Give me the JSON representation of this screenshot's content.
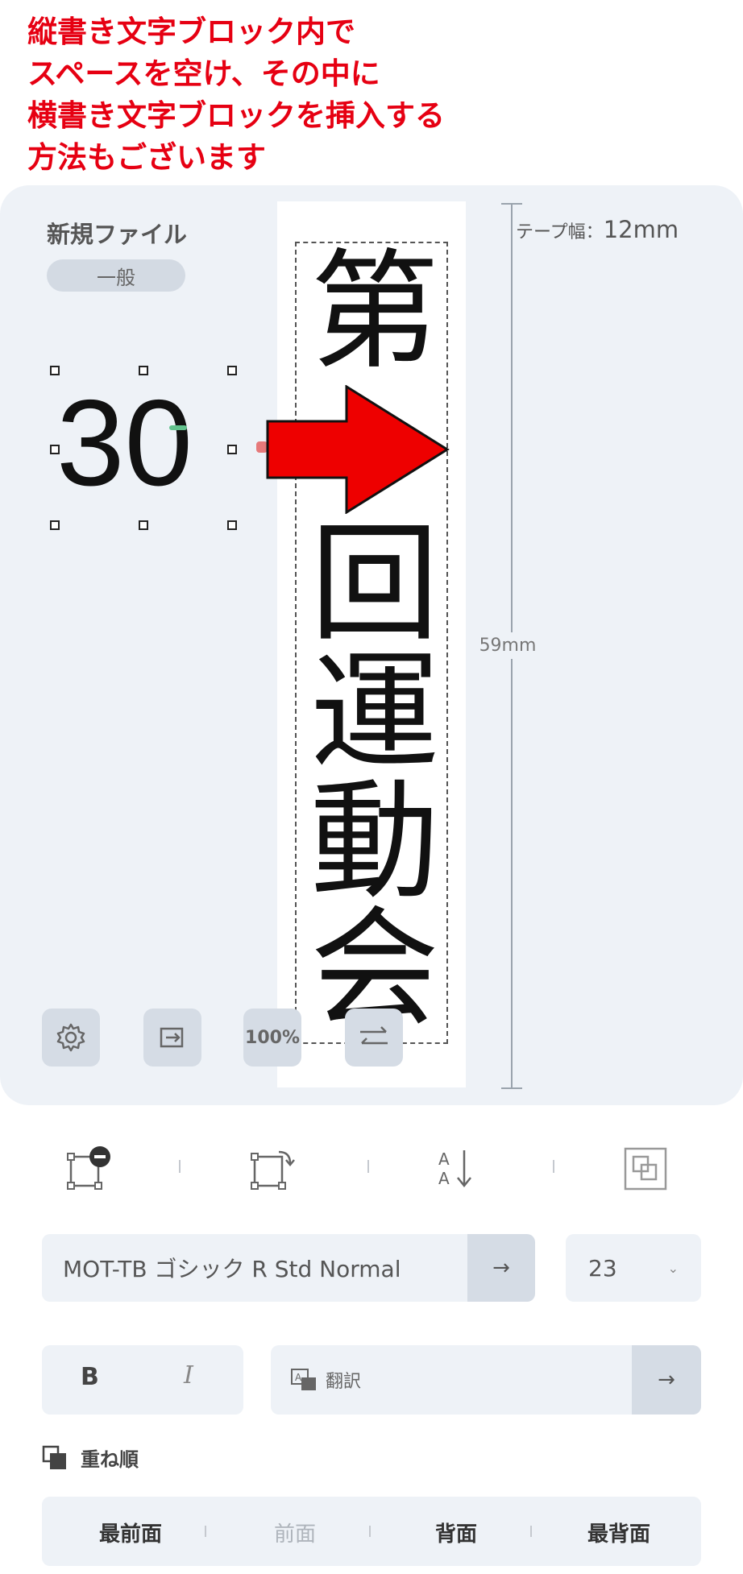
{
  "annotation": {
    "lines": [
      "縦書き文字ブロック内で",
      "スペースを空け、その中に",
      "横書き文字ブロックを挿入する",
      "方法もございます"
    ],
    "color": "#e60012"
  },
  "file": {
    "name": "新規ファイル",
    "category": "一般"
  },
  "tape": {
    "width_label": "テープ幅：",
    "width_value": "12mm",
    "length_label": "59mm"
  },
  "label_content": {
    "vertical_chars": [
      "第",
      "回",
      "運",
      "動",
      "会"
    ],
    "horizontal_text": "30"
  },
  "canvas_tools": {
    "zoom": "100%"
  },
  "font_panel": {
    "font_name": "MOT-TB ゴシック R Std Normal",
    "go_arrow": "→",
    "font_size": "23",
    "bold": "B",
    "italic": "I",
    "translate": "翻訳",
    "translate_arrow": "→"
  },
  "layer_order": {
    "heading": "重ね順",
    "items": [
      "最前面",
      "前面",
      "背面",
      "最背面"
    ]
  },
  "colors": {
    "panel": "#eef2f7",
    "button": "#d5dce5",
    "arrow": "#ee0000"
  }
}
